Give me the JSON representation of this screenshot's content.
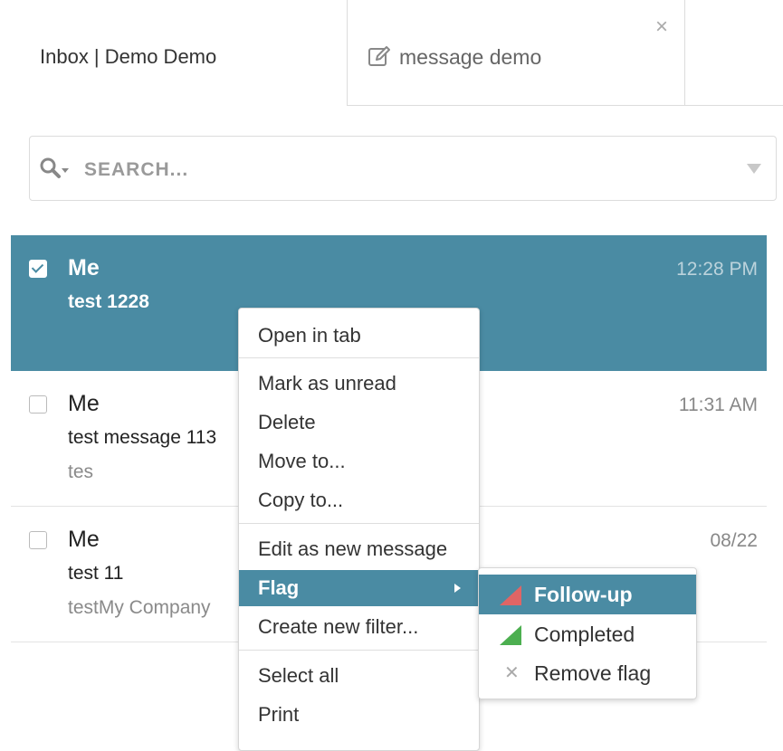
{
  "tabs": {
    "inbox_label": "Inbox | Demo Demo",
    "message_label": "message demo",
    "close_symbol": "×"
  },
  "search": {
    "placeholder": "SEARCH..."
  },
  "messages": [
    {
      "from": "Me",
      "subject": "test 1228",
      "snippet": "",
      "time": "12:28 PM",
      "selected": true,
      "checked": true
    },
    {
      "from": "Me",
      "subject": "test message 113",
      "snippet": "tes",
      "time": "11:31 AM",
      "selected": false,
      "checked": false
    },
    {
      "from": "Me",
      "subject": "test 11",
      "snippet": "testMy Company",
      "time": "08/22",
      "selected": false,
      "checked": false
    }
  ],
  "context_menu": {
    "items": [
      "Open in tab",
      "Mark as unread",
      "Delete",
      "Move to...",
      "Copy to...",
      "Edit as new message",
      "Flag",
      "Create new filter...",
      "Select all",
      "Print"
    ],
    "active_item": "Flag"
  },
  "flag_submenu": {
    "items": [
      "Follow-up",
      "Completed",
      "Remove flag"
    ],
    "active_item": "Follow-up"
  },
  "colors": {
    "accent": "#4a8ba3",
    "flag_followup": "#e06565",
    "flag_completed": "#4caf50"
  },
  "icons": {
    "search": "search-icon",
    "edit": "edit-icon",
    "close": "close-icon",
    "dropdown": "chevron-down-icon",
    "submenu_arrow": "chevron-right-icon",
    "remove_flag": "close-icon"
  }
}
